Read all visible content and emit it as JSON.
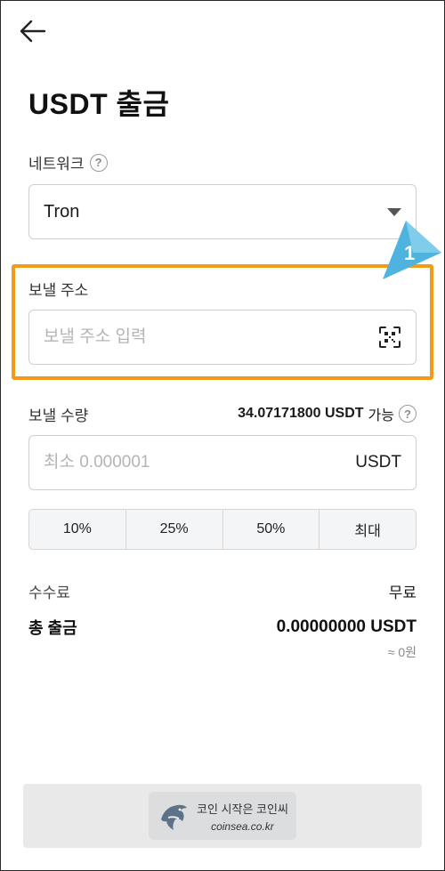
{
  "header": {
    "title": "USDT 출금"
  },
  "network": {
    "label": "네트워크",
    "selected": "Tron"
  },
  "address": {
    "label": "보낼 주소",
    "placeholder": "보낼 주소 입력"
  },
  "amount": {
    "label": "보낼 수량",
    "available_amount": "34.07171800 USDT",
    "available_suffix": "가능",
    "placeholder": "최소 0.000001",
    "unit": "USDT"
  },
  "percent_buttons": [
    "10%",
    "25%",
    "50%",
    "최대"
  ],
  "fee": {
    "label": "수수료",
    "value": "무료"
  },
  "total": {
    "label": "총 출금",
    "value": "0.00000000 USDT",
    "krw": "≈ 0원"
  },
  "step_marker": {
    "number": "1",
    "color": "#4fb3e0"
  },
  "highlight_color": "#f59a16",
  "banner": {
    "line1": "코인 시작은 코인씨",
    "line2": "coinsea.co.kr"
  },
  "icons": [
    "back-arrow-icon",
    "help-icon",
    "dropdown-caret-icon",
    "qr-scan-icon",
    "dolphin-logo-icon"
  ]
}
